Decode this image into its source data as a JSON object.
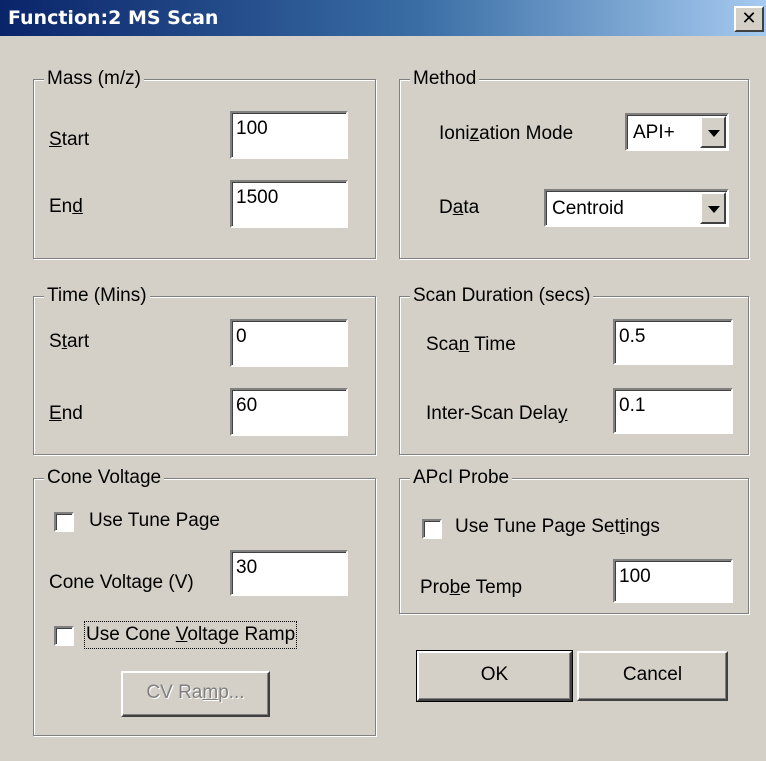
{
  "window": {
    "title": "Function:2 MS Scan",
    "close_glyph": "✕"
  },
  "mass": {
    "legend": "Mass (m/z)",
    "start_pre": "",
    "start_key": "S",
    "start_post": "tart",
    "start_value": "100",
    "end_pre": "En",
    "end_key": "d",
    "end_post": "",
    "end_value": "1500"
  },
  "method": {
    "legend": "Method",
    "ionization_pre": "Ioni",
    "ionization_key": "z",
    "ionization_post": "ation Mode",
    "ionization_value": "API+",
    "data_pre": "D",
    "data_key": "a",
    "data_post": "ta",
    "data_value": "Centroid"
  },
  "time": {
    "legend": "Time (Mins)",
    "start_pre": "S",
    "start_key": "t",
    "start_post": "art",
    "start_value": "0",
    "end_pre": "",
    "end_key": "E",
    "end_post": "nd",
    "end_value": "60"
  },
  "scan": {
    "legend": "Scan Duration (secs)",
    "scan_time_pre": "Sca",
    "scan_time_key": "n",
    "scan_time_post": " Time",
    "scan_time_value": "0.5",
    "delay_pre": "Inter-Scan Dela",
    "delay_key": "y",
    "delay_post": "",
    "delay_value": "0.1"
  },
  "cone": {
    "legend": "Cone Voltage",
    "use_tune_label": "Use Tune Page",
    "use_tune_checked": false,
    "voltage_label": "Cone Voltage (V)",
    "voltage_value": "30",
    "ramp_pre": "Use Cone ",
    "ramp_key": "V",
    "ramp_post": "oltage Ramp",
    "ramp_checked": false,
    "cv_pre": "CV Ra",
    "cv_key": "m",
    "cv_post": "p..."
  },
  "apci": {
    "legend": "APcI Probe",
    "use_tune_pre": "Use Tune Page Set",
    "use_tune_key": "t",
    "use_tune_post": "ings",
    "use_tune_checked": false,
    "temp_pre": "Pro",
    "temp_key": "b",
    "temp_post": "e Temp",
    "temp_value": "100"
  },
  "buttons": {
    "ok": "OK",
    "cancel": "Cancel"
  }
}
